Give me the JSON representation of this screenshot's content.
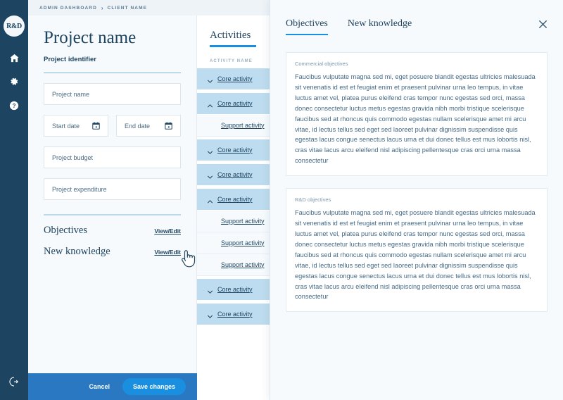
{
  "rail": {
    "logo_text": "R&D",
    "icons": [
      {
        "name": "home-icon"
      },
      {
        "name": "gear-icon"
      },
      {
        "name": "help-icon"
      }
    ],
    "logout": {
      "name": "logout-icon"
    }
  },
  "breadcrumb": {
    "items": [
      "ADMIN DASHBOARD",
      "CLIENT NAME"
    ],
    "separator": "›"
  },
  "form": {
    "title": "Project name",
    "identifier_label": "Project identifier",
    "fields": [
      {
        "name": "project-name-field",
        "placeholder": "Project name",
        "icon": null
      },
      {
        "name": "start-date-field",
        "placeholder": "Start date",
        "icon": "calendar-icon"
      },
      {
        "name": "end-date-field",
        "placeholder": "End date",
        "icon": "calendar-icon"
      },
      {
        "name": "project-budget-field",
        "placeholder": "Project budget",
        "icon": null
      },
      {
        "name": "project-expenditure-field",
        "placeholder": "Project expenditure",
        "icon": null
      }
    ],
    "links": [
      {
        "label": "Objectives",
        "action": "View/Edit"
      },
      {
        "label": "New knowledge",
        "action": "View/Edit"
      }
    ],
    "actions": {
      "cancel_label": "Cancel",
      "save_label": "Save changes"
    }
  },
  "activities": {
    "title": "Activities",
    "column_header": "ACTIVITY NAME",
    "rows": [
      {
        "type": "core",
        "label": "Core activity",
        "expanded": false
      },
      {
        "type": "core",
        "label": "Core activity",
        "expanded": true
      },
      {
        "type": "support",
        "label": "Support activity"
      },
      {
        "type": "core",
        "label": "Core activity",
        "expanded": false
      },
      {
        "type": "core",
        "label": "Core activity",
        "expanded": false
      },
      {
        "type": "core",
        "label": "Core activity",
        "expanded": true
      },
      {
        "type": "support",
        "label": "Support activity"
      },
      {
        "type": "support",
        "label": "Support activity"
      },
      {
        "type": "support",
        "label": "Support activity"
      },
      {
        "type": "core",
        "label": "Core activity",
        "expanded": false
      },
      {
        "type": "core",
        "label": "Core activity",
        "expanded": false
      }
    ]
  },
  "modal": {
    "tabs": [
      {
        "label": "Objectives",
        "active": true
      },
      {
        "label": "New knowledge",
        "active": false
      }
    ],
    "close_label": "×",
    "cards": [
      {
        "label": "Commercial objectives",
        "text": "Faucibus vulputate magna sed mi, eget posuere blandit egestas ultricies malesuada sit venenatis id est et feugiat enim et praesent pulvinar urna leo tempus, in vitae luctus amet vel, platea purus eleifend cras tempor nunc egestas sed orci, massa donec consectetur luctus metus egestas gravida nibh morbi tristique scelerisque faucibus sed at rhoncus quis commodo egestas nullam scelerisque amet mi arcu vitae, id lectus tellus sed eget sed laoreet pulvinar dignissim suspendisse quis egestas lacus congue senectus lacus urna et dui donec tellus est mus lobortis nisl, cras vitae lacus arcu eleifend nisl adipiscing pellentesque cras orci urna massa consectetur"
      },
      {
        "label": "R&D objectives",
        "text": "Faucibus vulputate magna sed mi, eget posuere blandit egestas ultricies malesuada sit venenatis id est et feugiat enim et praesent pulvinar urna leo tempus, in vitae luctus amet vel, platea purus eleifend cras tempor nunc egestas sed orci, massa donec consectetur luctus metus egestas gravida nibh morbi tristique scelerisque faucibus sed at rhoncus quis commodo egestas nullam scelerisque amet mi arcu vitae, id lectus tellus sed eget sed laoreet pulvinar dignissim suspendisse quis egestas lacus congue senectus lacus urna et dui donec tellus est mus lobortis nisl, cras vitae lacus arcu eleifend nisl adipiscing pellentesque cras orci urna massa consectetur"
      }
    ]
  },
  "colors": {
    "rail_bg": "#1d4461",
    "accent_blue": "#1a8fe0",
    "action_bar": "#2a78c2",
    "core_row": "#bedcef",
    "panel_bg": "#f7fafc"
  }
}
